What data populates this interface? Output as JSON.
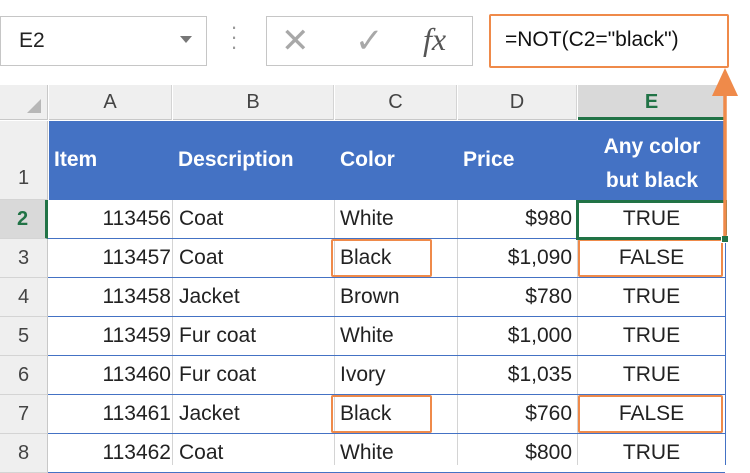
{
  "name_box": {
    "value": "E2"
  },
  "formula_bar": {
    "formula": "=NOT(C2=\"black\")",
    "fx_label": "fx",
    "cancel_glyph": "✕",
    "enter_glyph": "✓"
  },
  "columns": [
    "A",
    "B",
    "C",
    "D",
    "E"
  ],
  "selected_cell": "E2",
  "header_row": {
    "row_number": "1",
    "item": "Item",
    "description": "Description",
    "color": "Color",
    "price": "Price",
    "result_line1": "Any color",
    "result_line2": "but black"
  },
  "rows": [
    {
      "row": "2",
      "item": "113456",
      "description": "Coat",
      "color": "White",
      "price": "$980",
      "result": "TRUE"
    },
    {
      "row": "3",
      "item": "113457",
      "description": "Coat",
      "color": "Black",
      "price": "$1,090",
      "result": "FALSE"
    },
    {
      "row": "4",
      "item": "113458",
      "description": "Jacket",
      "color": "Brown",
      "price": "$780",
      "result": "TRUE"
    },
    {
      "row": "5",
      "item": "113459",
      "description": "Fur coat",
      "color": "White",
      "price": "$1,000",
      "result": "TRUE"
    },
    {
      "row": "6",
      "item": "113460",
      "description": "Fur coat",
      "color": "Ivory",
      "price": "$1,035",
      "result": "TRUE"
    },
    {
      "row": "7",
      "item": "113461",
      "description": "Jacket",
      "color": "Black",
      "price": "$760",
      "result": "FALSE"
    },
    {
      "row": "8",
      "item": "113462",
      "description": "Coat",
      "color": "White",
      "price": "$800",
      "result": "TRUE"
    }
  ],
  "colors": {
    "header_fill": "#4472c4",
    "highlight": "#ef8a4a",
    "excel_green": "#217346"
  }
}
